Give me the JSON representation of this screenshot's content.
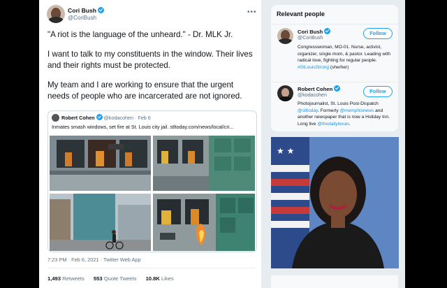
{
  "tweet": {
    "author_name": "Cori Bush",
    "author_handle": "@CoriBush",
    "paragraphs": [
      "\"A riot is the language of the unheard.\" - Dr. MLK Jr.",
      "I want to talk to my constituents in the window. Their lives and their rights must be protected.",
      "My team and I are working to ensure that the urgent needs of people who are incarcerated are not ignored."
    ],
    "quoted": {
      "author_name": "Robert Cohen",
      "author_handle": "@kodacohen",
      "date": "· Feb 6",
      "text": "Inmates smash windows, set fire at St. Louis city jail. stltoday.com/news/local/cri..."
    },
    "timestamp": "7:23 PM · Feb 6, 2021 · Twitter Web App",
    "stats": {
      "retweets_count": "1,493",
      "retweets_label": "Retweets",
      "quotes_count": "553",
      "quotes_label": "Quote Tweets",
      "likes_count": "10.8K",
      "likes_label": "Likes"
    },
    "more_glyph": "•••"
  },
  "relevant_people": {
    "title": "Relevant people",
    "follow_label": "Follow",
    "people": [
      {
        "name": "Cori Bush",
        "handle": "@CoriBush",
        "bio_text": "Congresswoman, MO-01. Nurse, activist, organizer, single mom, & pastor. Leading with radical love, fighting for regular people.",
        "bio_hashtag": "#StLouisStrong",
        "bio_suffix": " (she/her)"
      },
      {
        "name": "Robert Cohen",
        "handle": "@kodacohen",
        "bio_1": "Photojournalist, St. Louis Post-Dispatch ",
        "bio_link1": "@stltoday",
        "bio_2": ". Formerly ",
        "bio_link2": "@memphisnews",
        "bio_3": " and another newspaper that is now a Holiday Inn. Long live ",
        "bio_link3": "@thedailytexan",
        "bio_4": "."
      }
    ]
  },
  "colors": {
    "accent": "#1da1f2",
    "link": "#1b95e0",
    "muted": "#5b7083"
  }
}
